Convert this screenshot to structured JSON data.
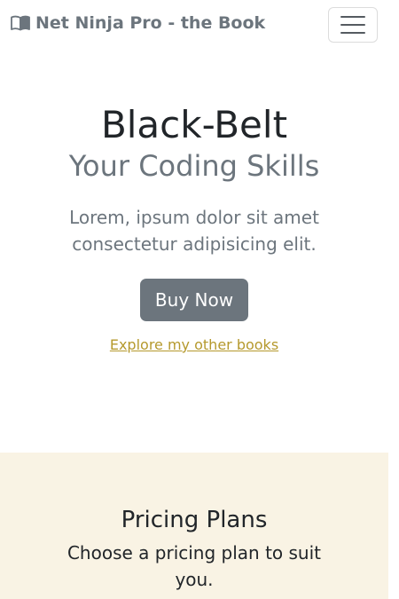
{
  "navbar": {
    "brand_icon": "book-icon",
    "brand_label": "Net Ninja Pro - the Book",
    "toggler_icon": "hamburger-menu-icon"
  },
  "hero": {
    "title": "Black-Belt",
    "subtitle": "Your Coding Skills",
    "text": "Lorem, ipsum dolor sit amet consectetur adipisicing elit.",
    "buy_button_label": "Buy Now",
    "explore_link_label": "Explore my other books"
  },
  "pricing": {
    "title": "Pricing Plans",
    "subtitle": "Choose a pricing plan to suit you."
  },
  "colors": {
    "muted": "#6c757d",
    "link": "#b5992d",
    "pricing_bg": "#f9f3e4",
    "dark_text": "#212529"
  }
}
